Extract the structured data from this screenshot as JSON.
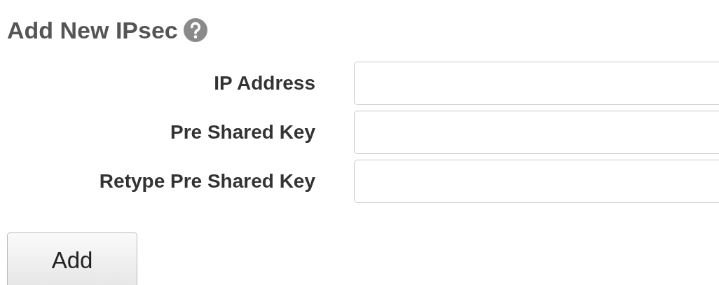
{
  "title": "Add New IPsec",
  "fields": [
    {
      "label": "IP Address"
    },
    {
      "label": "Pre Shared Key"
    },
    {
      "label": "Retype Pre Shared Key"
    }
  ],
  "button": "Add"
}
